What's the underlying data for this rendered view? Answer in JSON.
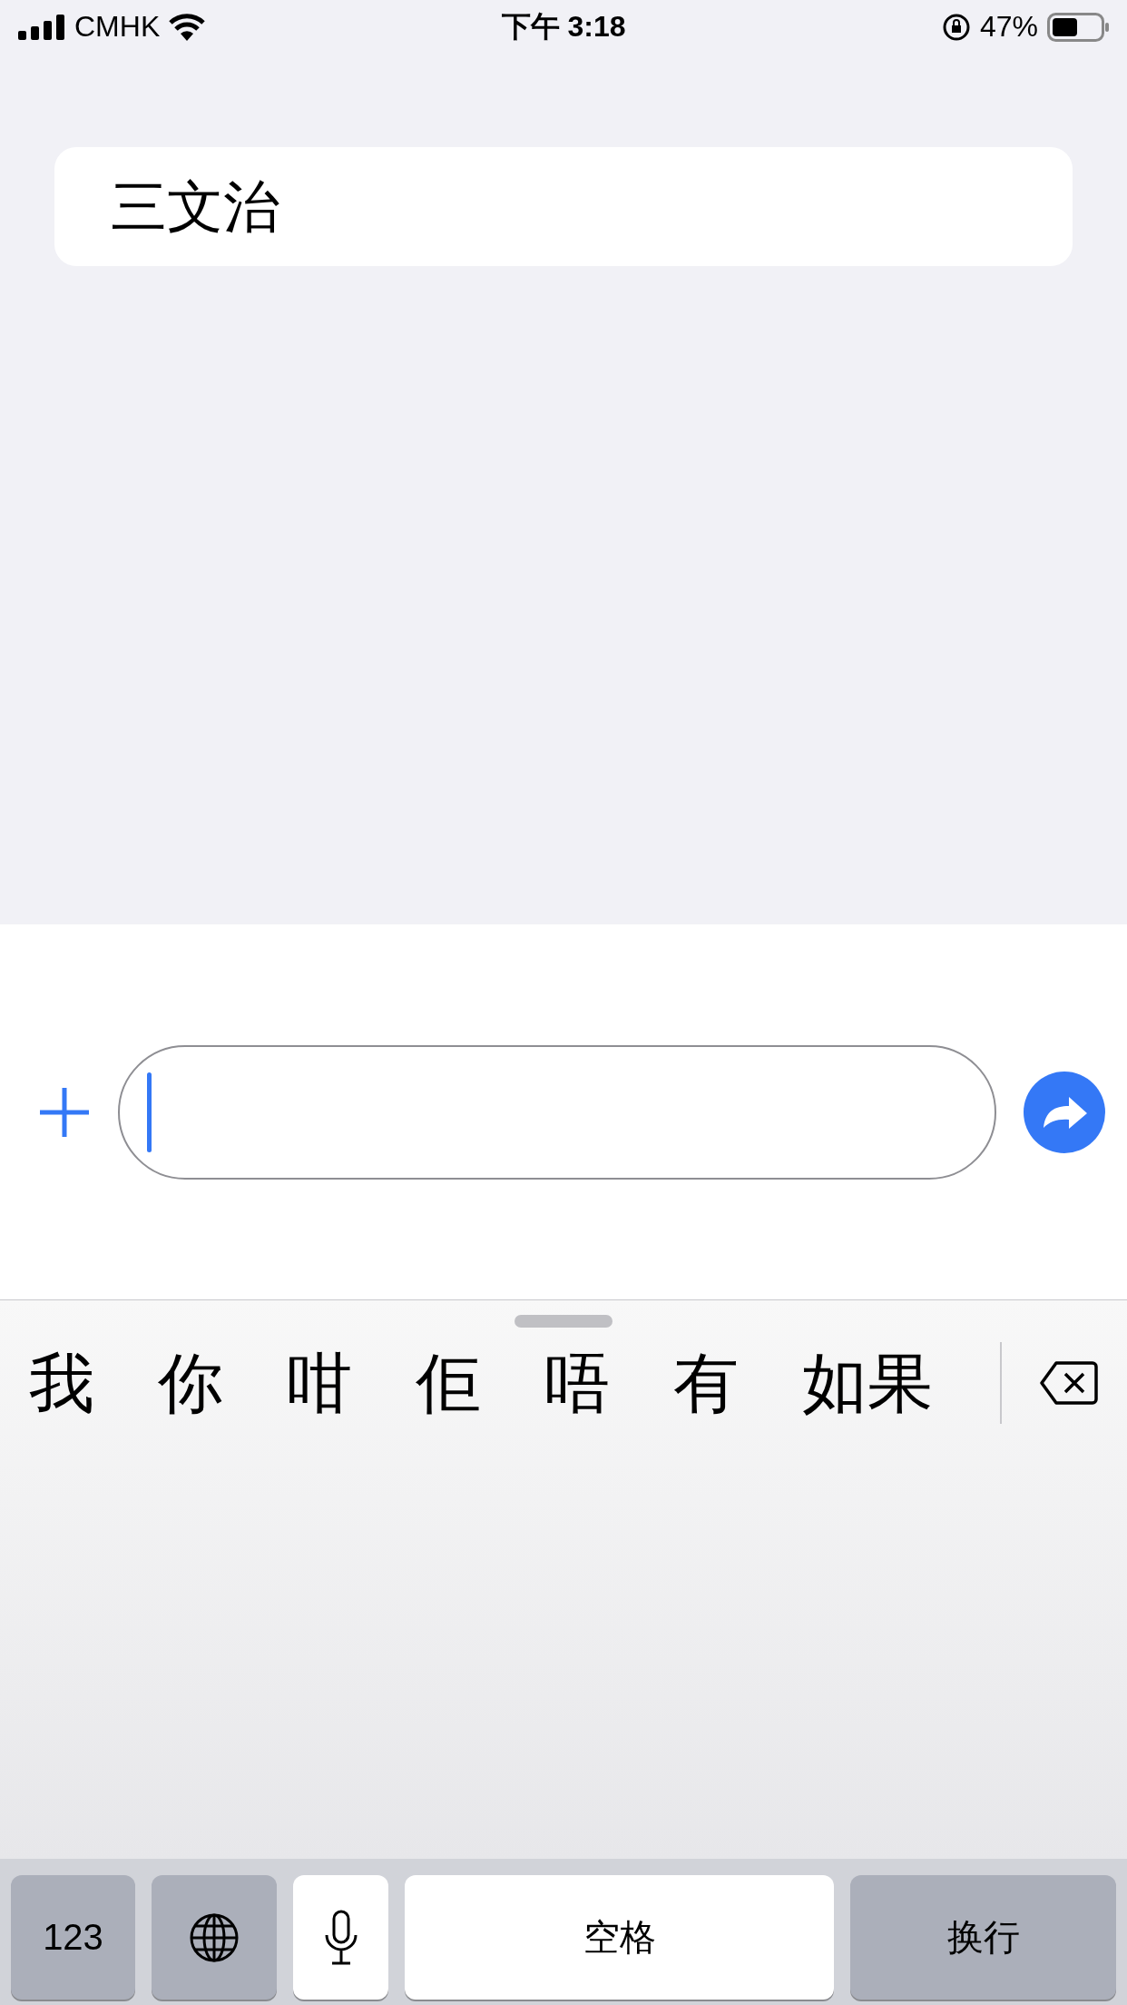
{
  "status_bar": {
    "carrier": "CMHK",
    "time": "下午 3:18",
    "battery": "47%"
  },
  "suggestion": "三文治",
  "candidates": [
    "我",
    "你",
    "咁",
    "佢",
    "唔",
    "有",
    "如果"
  ],
  "keys": [
    {
      "kind": "text",
      "label": "123"
    },
    {
      "kind": "globe"
    },
    {
      "kind": "mic"
    },
    {
      "kind": "space",
      "label": "空格"
    },
    {
      "kind": "return",
      "label": "换行"
    }
  ]
}
